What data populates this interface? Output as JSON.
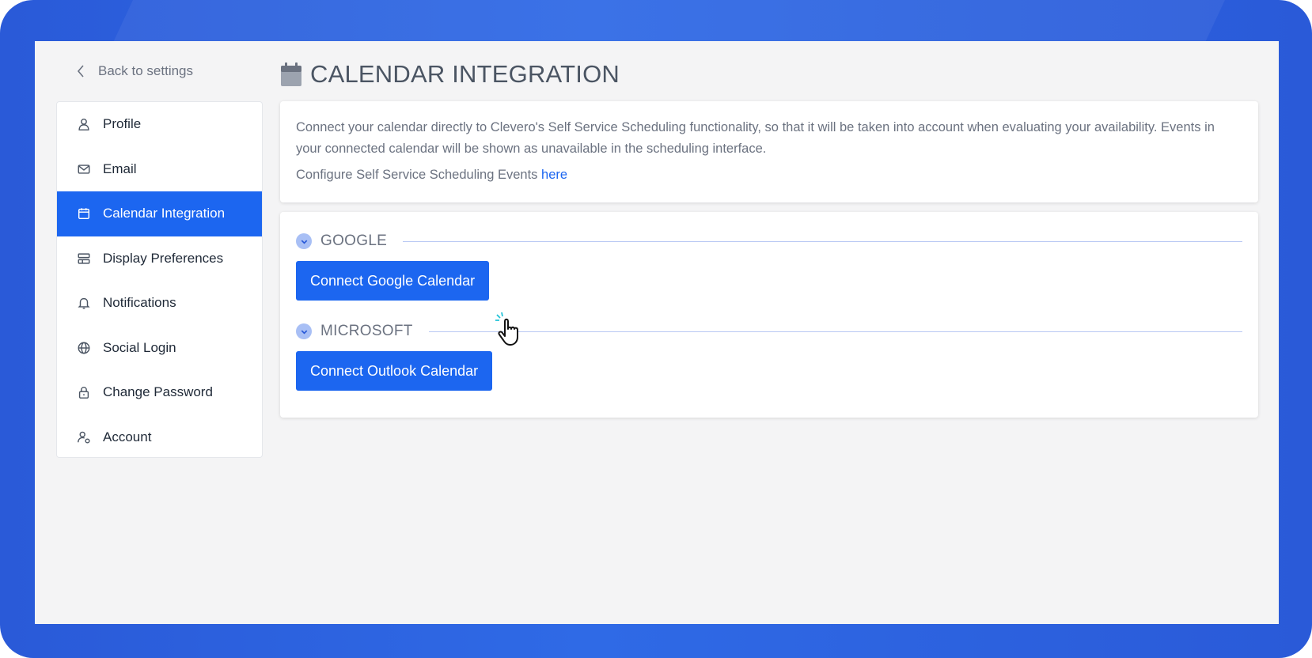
{
  "nav": {
    "back_label": "Back to settings",
    "items": [
      {
        "label": "Profile",
        "icon": "user-icon"
      },
      {
        "label": "Email",
        "icon": "envelope-icon"
      },
      {
        "label": "Calendar Integration",
        "icon": "calendar-icon",
        "active": true
      },
      {
        "label": "Display Preferences",
        "icon": "layout-icon"
      },
      {
        "label": "Notifications",
        "icon": "bell-icon"
      },
      {
        "label": "Social Login",
        "icon": "globe-icon"
      },
      {
        "label": "Change Password",
        "icon": "lock-icon"
      },
      {
        "label": "Account",
        "icon": "user-gear-icon"
      }
    ]
  },
  "page": {
    "title": "CALENDAR INTEGRATION",
    "description": "Connect your calendar directly to Clevero's Self Service Scheduling functionality, so that it will be taken into account when evaluating your availability. Events in your connected calendar will be shown as unavailable in the scheduling interface.",
    "configure_text": "Configure Self Service Scheduling Events",
    "configure_link": "here"
  },
  "providers": {
    "google": {
      "heading": "GOOGLE",
      "button": "Connect Google Calendar"
    },
    "microsoft": {
      "heading": "MICROSOFT",
      "button": "Connect Outlook Calendar"
    }
  },
  "colors": {
    "accent": "#1c66f0",
    "frame": "#2f6ae6",
    "background": "#f4f4f5"
  }
}
